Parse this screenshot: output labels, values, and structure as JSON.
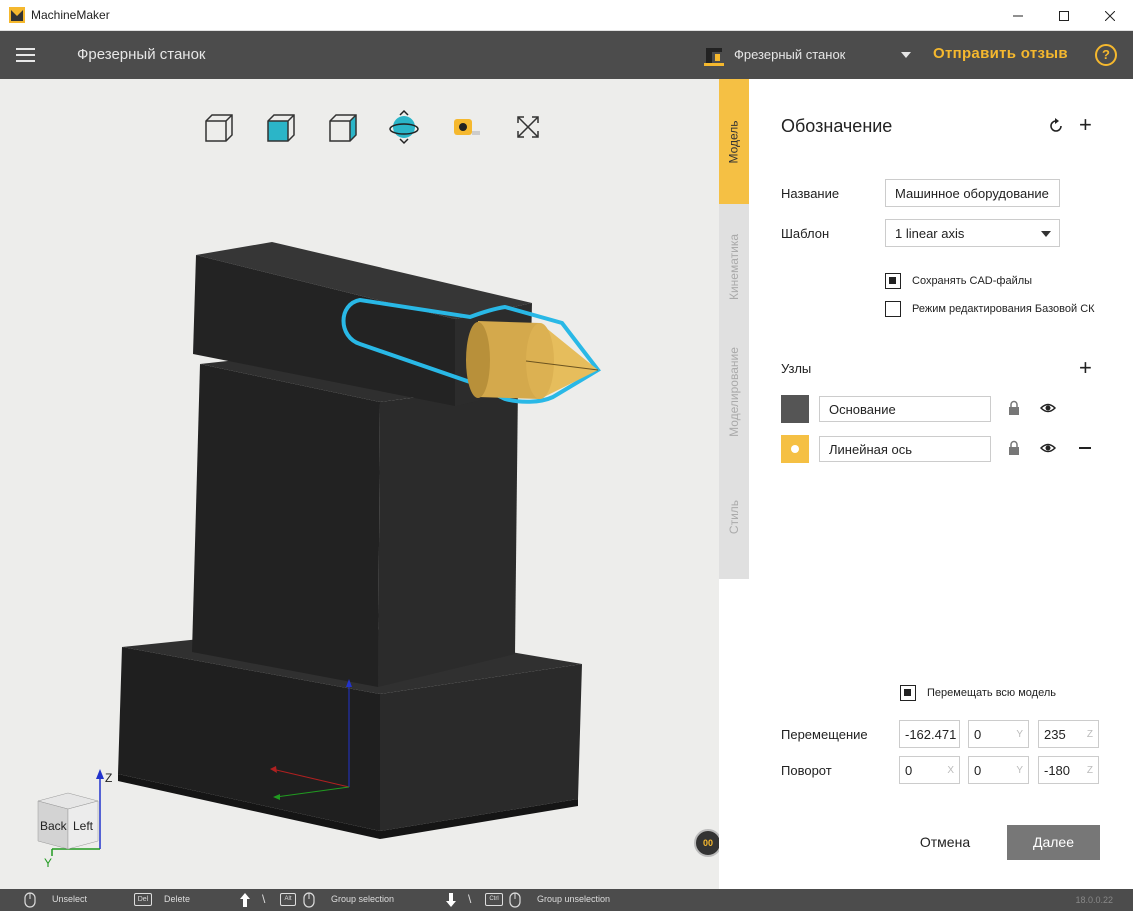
{
  "window": {
    "title": "MachineMaker",
    "icons": [
      "app-logo-icon",
      "minimize-icon",
      "maximize-icon",
      "close-icon"
    ]
  },
  "header": {
    "doc_title": "Фрезерный станок",
    "machine_select": "Фрезерный станок",
    "feedback": "Отправить отзыв",
    "help": "?",
    "accent_color": "#f5b82e"
  },
  "viewport": {
    "toolbar_icons": [
      "view-top-icon",
      "view-front-icon",
      "view-side-icon",
      "orbit-icon",
      "measure-tape-icon",
      "fit-view-icon"
    ],
    "axis_cube": {
      "back": "Back",
      "left": "Left",
      "z": "Z",
      "y": "Y"
    },
    "fps_badge": "00"
  },
  "tabs": [
    {
      "label": "Модель",
      "active": true
    },
    {
      "label": "Кинематика",
      "active": false
    },
    {
      "label": "Моделирование",
      "active": false
    },
    {
      "label": "Стиль",
      "active": false
    }
  ],
  "panel": {
    "title": "Обозначение",
    "name_label": "Название",
    "name_value": "Машинное оборудование",
    "template_label": "Шаблон",
    "template_value": "1 linear axis",
    "save_cad": "Сохранять CAD-файлы",
    "save_cad_checked": true,
    "edit_base": "Режим редактирования Базовой СК",
    "edit_base_checked": false,
    "nodes_label": "Узлы",
    "nodes": [
      {
        "name": "Основание",
        "color": "#555555"
      },
      {
        "name": "Линейная ось",
        "color": "#f5c044"
      }
    ],
    "move_all": "Перемещать всю модель",
    "move_all_checked": true,
    "translation_label": "Перемещение",
    "translation": {
      "x": "-162.471",
      "y": "0",
      "z": "235"
    },
    "rotation_label": "Поворот",
    "rotation": {
      "x": "0",
      "y": "0",
      "z": "-180"
    },
    "axis_x": "X",
    "axis_y": "Y",
    "axis_z": "Z",
    "cancel": "Отмена",
    "next": "Далее"
  },
  "statusbar": {
    "unselect": "Unselect",
    "del_key": "Del",
    "delete": "Delete",
    "alt_key": "Alt",
    "group_selection": "Group selection",
    "ctrl_key": "Ctrl",
    "group_unselection": "Group unselection",
    "version": "18.0.0.22"
  }
}
